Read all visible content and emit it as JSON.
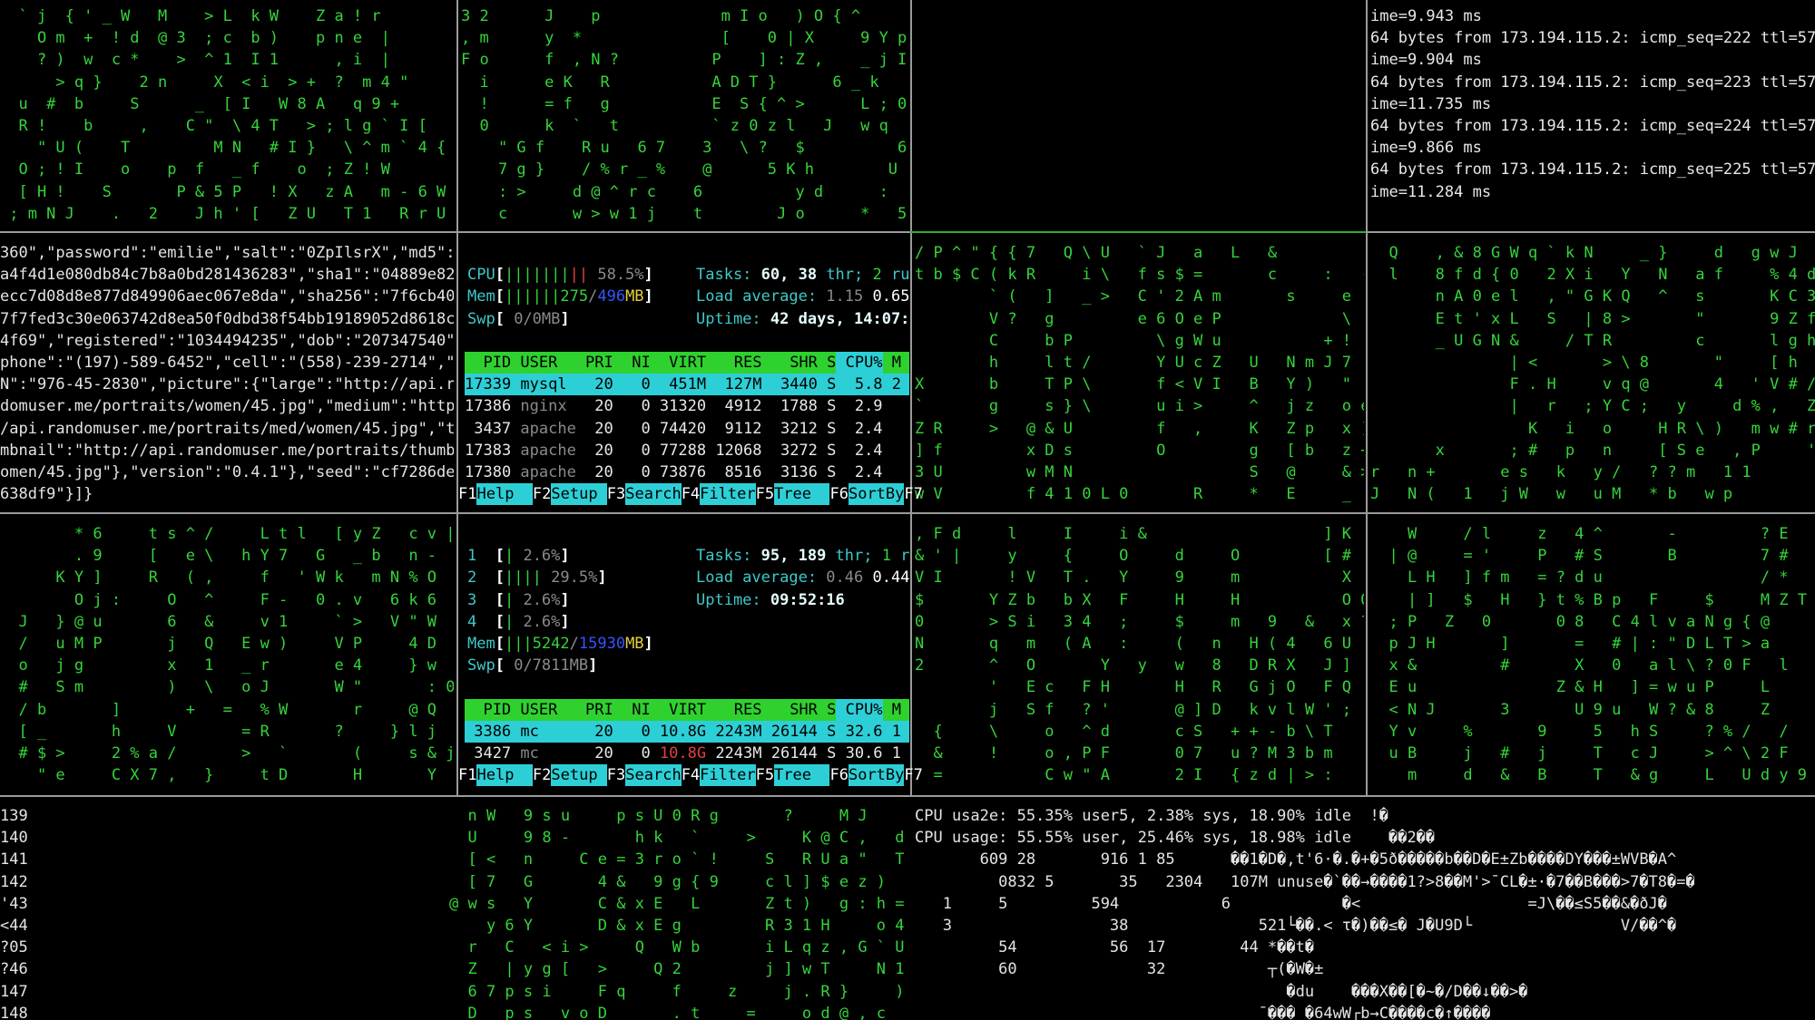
{
  "colors": {
    "rain_green": "#35d43a",
    "htop_header_green": "#2fd12f",
    "htop_selection_cyan": "#2dcfd6",
    "divider": "#9a9a9a",
    "background": "#000000"
  },
  "panes": {
    "top_left_rain": [
      "  ` j  { ' _ W   M    > L  k W    Z a ! r",
      "    O m  +  ! d  @ 3  ; c  b )    p n e  |",
      "    ? )  w  c *    >  ^ 1  I 1      , i  |",
      "      > q }    2 n     X  < i  > +  ?  m 4 \"",
      "  u  #  b     S      _  [ I   W 8 A   q 9 +",
      "  R !    b     ,    C \"  \\ 4 T   > ; l g ` I [",
      "    \" U (    T         M N   # I }   \\ ^ m ` 4 {",
      "  O ; ! I    o    p  f   _ f    o  ; Z ! W",
      "  [ H !    S       P & 5 P   ! X   z A   m - 6 W",
      " ; m N J    .   2    J h ' [   Z U   T 1   R r U ;"
    ],
    "top_mid_rain": [
      "3 2      J    p             m I o   ) O { ^      W",
      ", m      y  *               [    0 | X     9 Y p   1",
      "F o      f  , N ?          P    ] : Z ,    _ j I  T R",
      "  i      e K   R           A D T }      6 _ k   6 J",
      "  !      = f   g           E  S { ^ >      L ; 0   6",
      "  0      k  `   t          ` z 0 z l   J   w q",
      "    \" G f    R u   6 7    3   \\ ?   $          6",
      "    7 g }    / % r _ %    @      5 K h        U P",
      "    : >     d @ ^ r c    6          y d      :   T",
      "    c       w > w 1 j    t        J o      *   5"
    ],
    "ping": [
      "ime=9.943 ms",
      "64 bytes from 173.194.115.2: icmp_seq=222 ttl=57 t",
      "ime=9.904 ms",
      "64 bytes from 173.194.115.2: icmp_seq=223 ttl=57 t",
      "ime=11.735 ms",
      "64 bytes from 173.194.115.2: icmp_seq=224 ttl=57 t",
      "ime=9.866 ms",
      "64 bytes from 173.194.115.2: icmp_seq=225 ttl=57 t",
      "ime=11.284 ms"
    ],
    "json_dump": [
      "360\",\"password\":\"emilie\",\"salt\":\"0ZpIlsrX\",\"md5\":\"3",
      "a4f4d1e080db84c7b8a0bd281436283\",\"sha1\":\"04889e828c",
      "ecc7d08d8e877d849906aec067e8da\",\"sha256\":\"7f6cb4048",
      "7f7fed3c30e063742d8ea50f0dbd38f54bb19189052d8618cbc",
      "4f69\",\"registered\":\"1034494235\",\"dob\":\"207347540\",\"",
      "phone\":\"(197)-589-6452\",\"cell\":\"(558)-239-2714\",\"SS",
      "N\":\"976-45-2830\",\"picture\":{\"large\":\"http://api.ran",
      "domuser.me/portraits/women/45.jpg\",\"medium\":\"http:/",
      "/api.randomuser.me/portraits/med/women/45.jpg\",\"thu",
      "mbnail\":\"http://api.randomuser.me/portraits/thumb/w",
      "omen/45.jpg\"},\"version\":\"0.4.1\"},\"seed\":\"cf7286deb4",
      "638df9\"}]}"
    ],
    "mid_right_rain": [
      "/ P ^ \" { { 7   Q \\ U   ` J   a   L   &",
      "t b $ C ( k R     i \\   f s $ =       c     :   (",
      "        ` (   ]   _ >   C ' 2 A m       s     e   e",
      "        V ?   g         e 6 O e P             \\   m",
      "        C     b P         \\ g W u           + !   E",
      "        h     l t /       Y U c Z   U   N m J 7",
      "X       b     T P \\       f < V I   B   Y )   \"",
      "`       g     s } \\       u i >     ^   j z   o e",
      "Z R     >   @ & U         f   ,     K   Z p   x )",
      "] f         x D s         O         g   [ b   z +",
      "3 U         w M N                   S   @     & >",
      "w V         f 4 1 0 L 0       R     *   E     _"
    ],
    "mid_far_rain": [
      "  Q    , & 8 G W q ` k N     _ }     d   g w J",
      "  l    8 f d { 0   2 X i   Y   N   a f     % 4 d +",
      "       n A 0 e l   , \" G K Q   ^   s       K C 3",
      "       E t ' x L   S   | 8 >       \"       9 Z f",
      "       _ U G N &     / T R         c       l g h",
      "               | <       > \\ 8       \"     [ h   <",
      "               F . H     v q @       4   ' V # / +",
      "               |   r   ; Y C ;   y     d % ,   Z a",
      "                 K   i   o     H R \\ )   m w # r",
      "       x       ; #   p   n     [ S e   , P     '",
      "r   n +       e s   k   y /   ? ? m   1 1       '",
      "J   N (   1   j W   w   u M   * b   w p"
    ],
    "low_left_rain": [
      "        * 6     t s ^ /     L t l   [ y Z   c v |",
      "        . 9     [   e \\   h Y 7   G   _ b   n -",
      "      K Y ]     R   ( ,     f   ' W k   m N % O",
      "        O j :     O   ^     F -   0 . v   6 k 6",
      "  J   } @ u       6   &     v 1     ` >   V \" W",
      "  /   u M P       j   Q   E w )     V P     4 D",
      "  o   j g         x   1   _ r       e 4     } w",
      "  #   S m         )   \\   o J       W \"       : 0",
      "  / b       ]       +   =   % W       r     @ Q",
      "  [ _       h     V       = R       ?     } l j",
      "  # $ >     2 % a /       >   `       (     s & j",
      "    \" e     C X 7 ,   }     t D       H       Y   M"
    ],
    "low_right_rain": [
      ", F d     l     I     i &                   ] K",
      "& ' |     y     {     O     d     O         [ #",
      "V I       ! V   T .   Y     9     m           X",
      "$       Y Z b   b X   F     H     H           O Q",
      "0       > S i   3 4   ;     $     m   9   &   x ?",
      "N       q   m   ( A   :     (   n   H ( 4   6 U   @ *",
      "2       ^   O       Y   y   w   8   D R X   J ]   Q .",
      "        '   E c   F H       H   R   G j O   F Q   f G",
      "        j   S f   ? '       @ ] D   k v l W ' ;   7 D",
      "  {     \\     o   ^ d       c S   + + - b \\ T     d",
      "  &     !     o , P F       0 7   u ? M 3 b m",
      "  =           C w \" A       2 I   { z d | > :"
    ],
    "low_far_rain": [
      "    W     / l     z   4 ^       -         ? E",
      "  | @     = '     P   # S       B         7 #",
      "    L H   ] f m   = ? d u                 / *",
      "    | ]   $   H   } t % B p   F     $     M Z T",
      "  ; P   Z   0       0 8   C 4 l v a N g { @",
      "  p J H       ]       =   # | : \" D L T > a",
      "  x &         #       X   0   a l \\ ? 0 F   l",
      "  E u               Z & H   ] = w u P     L",
      "  < N J       3       U 9 u   W ? & 8     Z",
      "  Y v     %       9     5   h S     ? % /   /",
      "  u B     j   #   j     T   c J     > ^ \\ 2 F   i",
      "    m     d   &   B     T   & g     L   U d y 9"
    ],
    "line_numbers": [
      "139",
      "140",
      "141",
      "142",
      "'43",
      "<44",
      "?05",
      "?46",
      "147",
      "148"
    ],
    "bottom_mid_rain": [
      "  n W   9 s u     p s U 0 R g       ?     M J",
      "  U     9 8 -       h k   `     >     K @ C ,   d",
      "  [ <   n     C e = 3 r o ` !     S   R U a \"   T",
      "  [ 7   G       4 &   9 g { 9     c l ] $ e z )   X",
      "@ w s   Y       C & x E   L       Z t )   g : h =   K",
      "    y 6 Y       D & x E g         R 3 1 H     o 4",
      "  r   C   < i >     Q   W b       i L q z , G ` U   v",
      "  Z   | y g [   >     Q 2         j ] w T     N 1",
      "  6 7 p s i     F q     f     z     j . R }     ) 1",
      "  D   p s   v o D       . t     =     o d @ , c     ) g ^"
    ],
    "top_output": [
      "CPU usa2e: 55.35% user5, 2.38% sys, 18.90% idle  !�",
      "CPU usage: 55.55% user, 25.46% sys, 18.98% idle    ��2��",
      "       609 28       916 1 85      ��1�D�,t'6·�.�+�5ð�����b��D�E±Zb����DY���±WVB�A^",
      "         0832 5       35   2304   107M unuse�`��→����1?>8��M'>¯CL�±·�7��B���>7�T8�=�",
      "   1     5         594           6            �<                  =J\\��≤S5��&�ðJ�",
      "   3                 38              521└��.< τ�)��≤� J�U9D└                V/��^�",
      "         54          56  17        44 *��t�",
      "         60              32           ┬(�W�±",
      "                                        �du    ���X��[�~�/D��↓��>�",
      "                                     ¯��� �64wW┌b→C����c�↑����"
    ]
  },
  "htop1": {
    "meters": [
      {
        "label": "CPU",
        "percent": 58.5,
        "value": "58.5%"
      },
      {
        "label": "Mem",
        "percent": 55.4,
        "used": "275",
        "total": "496",
        "unit": "MB"
      },
      {
        "label": "Swp",
        "percent": 0,
        "value": "0/0MB"
      }
    ],
    "tasks_label": "Tasks: ",
    "tasks": "60, 38",
    "thr_label": " thr; ",
    "running": "2",
    "running_suffix": " ru",
    "load_label": "Load average: ",
    "load1": "1.15",
    "load5": "0.65",
    "uptime_label": "Uptime: ",
    "uptime": "42 days, 14:07:",
    "columns": [
      "PID",
      "USER",
      "PRI",
      "NI",
      "VIRT",
      "RES",
      "SHR",
      "S",
      "CPU%",
      "M"
    ],
    "processes": [
      {
        "pid": "17339",
        "user": "mysql",
        "pri": "20",
        "ni": "0",
        "virt": "451M",
        "res": "127M",
        "shr": "3440",
        "s": "S",
        "cpu": "5.8",
        "mem": "2",
        "selected": true
      },
      {
        "pid": "17386",
        "user": "nginx",
        "pri": "20",
        "ni": "0",
        "virt": "31320",
        "res": "4912",
        "shr": "1788",
        "s": "S",
        "cpu": "2.9",
        "mem": ""
      },
      {
        "pid": "3437",
        "user": "apache",
        "pri": "20",
        "ni": "0",
        "virt": "74420",
        "res": "9112",
        "shr": "3212",
        "s": "S",
        "cpu": "2.4",
        "mem": ""
      },
      {
        "pid": "17383",
        "user": "apache",
        "pri": "20",
        "ni": "0",
        "virt": "77288",
        "res": "12068",
        "shr": "3272",
        "s": "S",
        "cpu": "2.4",
        "mem": ""
      },
      {
        "pid": "17380",
        "user": "apache",
        "pri": "20",
        "ni": "0",
        "virt": "73876",
        "res": "8516",
        "shr": "3136",
        "s": "S",
        "cpu": "2.4",
        "mem": ""
      }
    ],
    "fkeys": [
      {
        "key": "F1",
        "label": "Help"
      },
      {
        "key": "F2",
        "label": "Setup"
      },
      {
        "key": "F3",
        "label": "Search"
      },
      {
        "key": "F4",
        "label": "Filter"
      },
      {
        "key": "F5",
        "label": "Tree"
      },
      {
        "key": "F6",
        "label": "SortBy"
      },
      {
        "key": "F7",
        "label": ""
      }
    ]
  },
  "htop2": {
    "meters": [
      {
        "label": "1",
        "percent": 2.6,
        "value": "2.6%"
      },
      {
        "label": "2",
        "percent": 29.5,
        "value": "29.5%"
      },
      {
        "label": "3",
        "percent": 2.6,
        "value": "2.6%"
      },
      {
        "label": "4",
        "percent": 2.6,
        "value": "2.6%"
      },
      {
        "label": "Mem",
        "percent": 32.9,
        "used": "5242",
        "total": "15930",
        "unit": "MB"
      },
      {
        "label": "Swp",
        "percent": 0,
        "value": "0/7811MB"
      }
    ],
    "tasks_label": "Tasks: ",
    "tasks": "95, 189",
    "thr_label": " thr; ",
    "running": "1",
    "running_suffix": " r",
    "load_label": "Load average: ",
    "load1": "0.46",
    "load5": "0.44",
    "uptime_label": "Uptime: ",
    "uptime": "09:52:16",
    "columns": [
      "PID",
      "USER",
      "PRI",
      "NI",
      "VIRT",
      "RES",
      "SHR",
      "S",
      "CPU%",
      "M"
    ],
    "processes": [
      {
        "pid": "3386",
        "user": "mc",
        "pri": "20",
        "ni": "0",
        "virt": "10.8G",
        "res": "2243M",
        "shr": "26144",
        "s": "S",
        "cpu": "32.6",
        "mem": "1",
        "selected": true
      },
      {
        "pid": "3427",
        "user": "mc",
        "pri": "20",
        "ni": "0",
        "virt": "10.8G",
        "res": "2243M",
        "shr": "26144",
        "s": "S",
        "cpu": "30.6",
        "mem": "1",
        "virt_alert": true
      }
    ],
    "fkeys": [
      {
        "key": "F1",
        "label": "Help"
      },
      {
        "key": "F2",
        "label": "Setup"
      },
      {
        "key": "F3",
        "label": "Search"
      },
      {
        "key": "F4",
        "label": "Filter"
      },
      {
        "key": "F5",
        "label": "Tree"
      },
      {
        "key": "F6",
        "label": "SortBy"
      },
      {
        "key": "F7",
        "label": ""
      }
    ]
  }
}
